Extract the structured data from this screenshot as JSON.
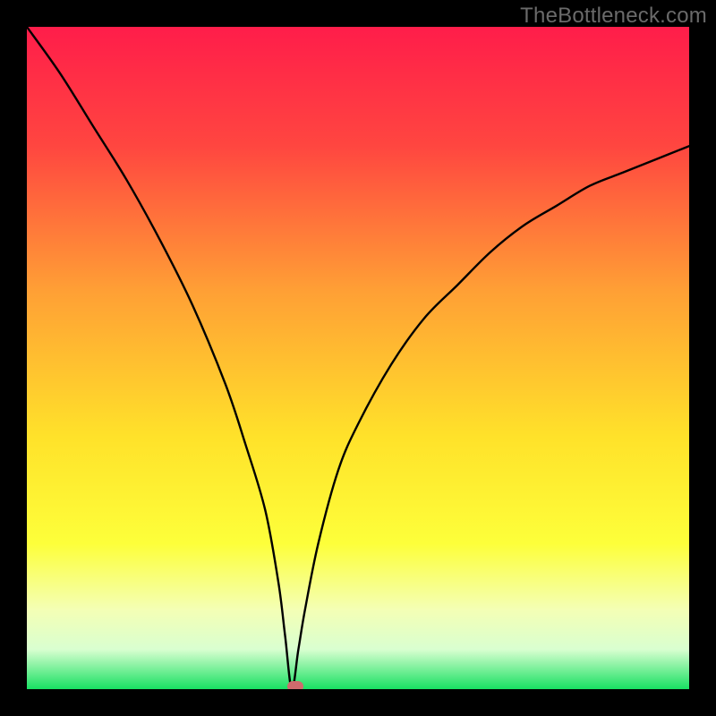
{
  "watermark": "TheBottleneck.com",
  "colors": {
    "frame": "#000000",
    "curve": "#000000",
    "marker": "#cf6b6d",
    "gradient_stops": [
      {
        "pct": 0,
        "color": "#ff1d4a"
      },
      {
        "pct": 18,
        "color": "#ff4640"
      },
      {
        "pct": 40,
        "color": "#ffa035"
      },
      {
        "pct": 62,
        "color": "#ffe22a"
      },
      {
        "pct": 78,
        "color": "#fdff3a"
      },
      {
        "pct": 88,
        "color": "#f4ffb5"
      },
      {
        "pct": 94,
        "color": "#d9ffd0"
      },
      {
        "pct": 100,
        "color": "#18e062"
      }
    ]
  },
  "chart_data": {
    "type": "line",
    "title": "",
    "xlabel": "",
    "ylabel": "",
    "xlim": [
      0,
      100
    ],
    "ylim": [
      0,
      100
    ],
    "legend": false,
    "grid": false,
    "annotations": [
      "TheBottleneck.com"
    ],
    "minimum": {
      "x": 40,
      "y": 0
    },
    "series": [
      {
        "name": "bottleneck-curve",
        "x": [
          0,
          5,
          10,
          15,
          20,
          25,
          30,
          33,
          36,
          38,
          39,
          40,
          41,
          42,
          44,
          47,
          50,
          55,
          60,
          65,
          70,
          75,
          80,
          85,
          90,
          95,
          100
        ],
        "values": [
          100,
          93,
          85,
          77,
          68,
          58,
          46,
          37,
          27,
          16,
          8,
          0,
          6,
          12,
          22,
          33,
          40,
          49,
          56,
          61,
          66,
          70,
          73,
          76,
          78,
          80,
          82
        ]
      }
    ],
    "marker_point": {
      "x": 40.5,
      "y": 0
    }
  }
}
